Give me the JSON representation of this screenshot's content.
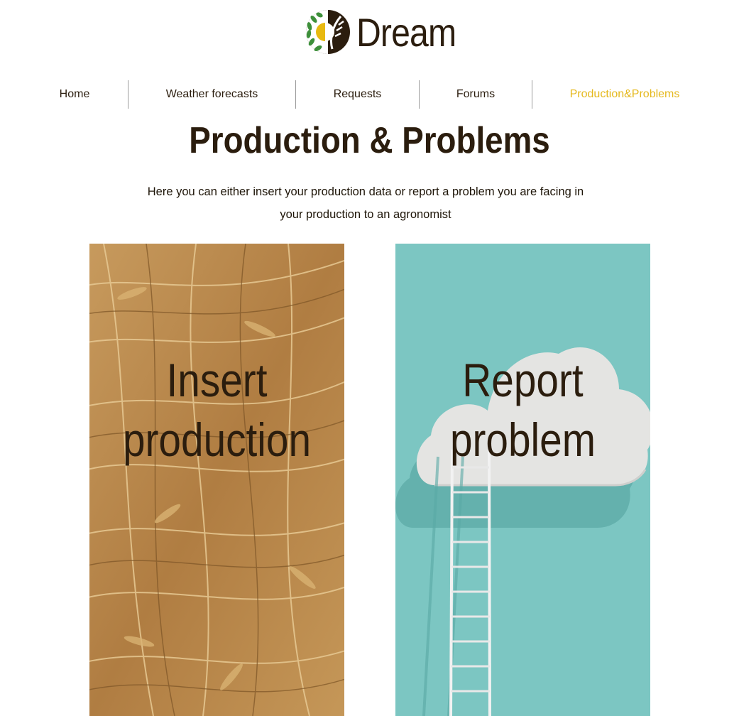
{
  "brand": {
    "name": "Dream",
    "logo_icon": "wheat-sun-logo-icon"
  },
  "nav": {
    "items": [
      {
        "label": "Home"
      },
      {
        "label": "Weather forecasts"
      },
      {
        "label": "Requests"
      },
      {
        "label": "Forums"
      },
      {
        "label": "Production&Problems",
        "active": true
      }
    ]
  },
  "page": {
    "title": "Production & Problems",
    "intro": "Here you can either insert your production data or report a problem you are facing in your production to an agronomist"
  },
  "cards": {
    "insert": {
      "line1": "Insert",
      "line2": "production"
    },
    "report": {
      "line1": "Report",
      "line2": "problem"
    }
  },
  "colors": {
    "accent": "#e5b81c",
    "text": "#2b1d0e",
    "teal": "#7cc6c2",
    "wheat": "#b88a4f"
  }
}
